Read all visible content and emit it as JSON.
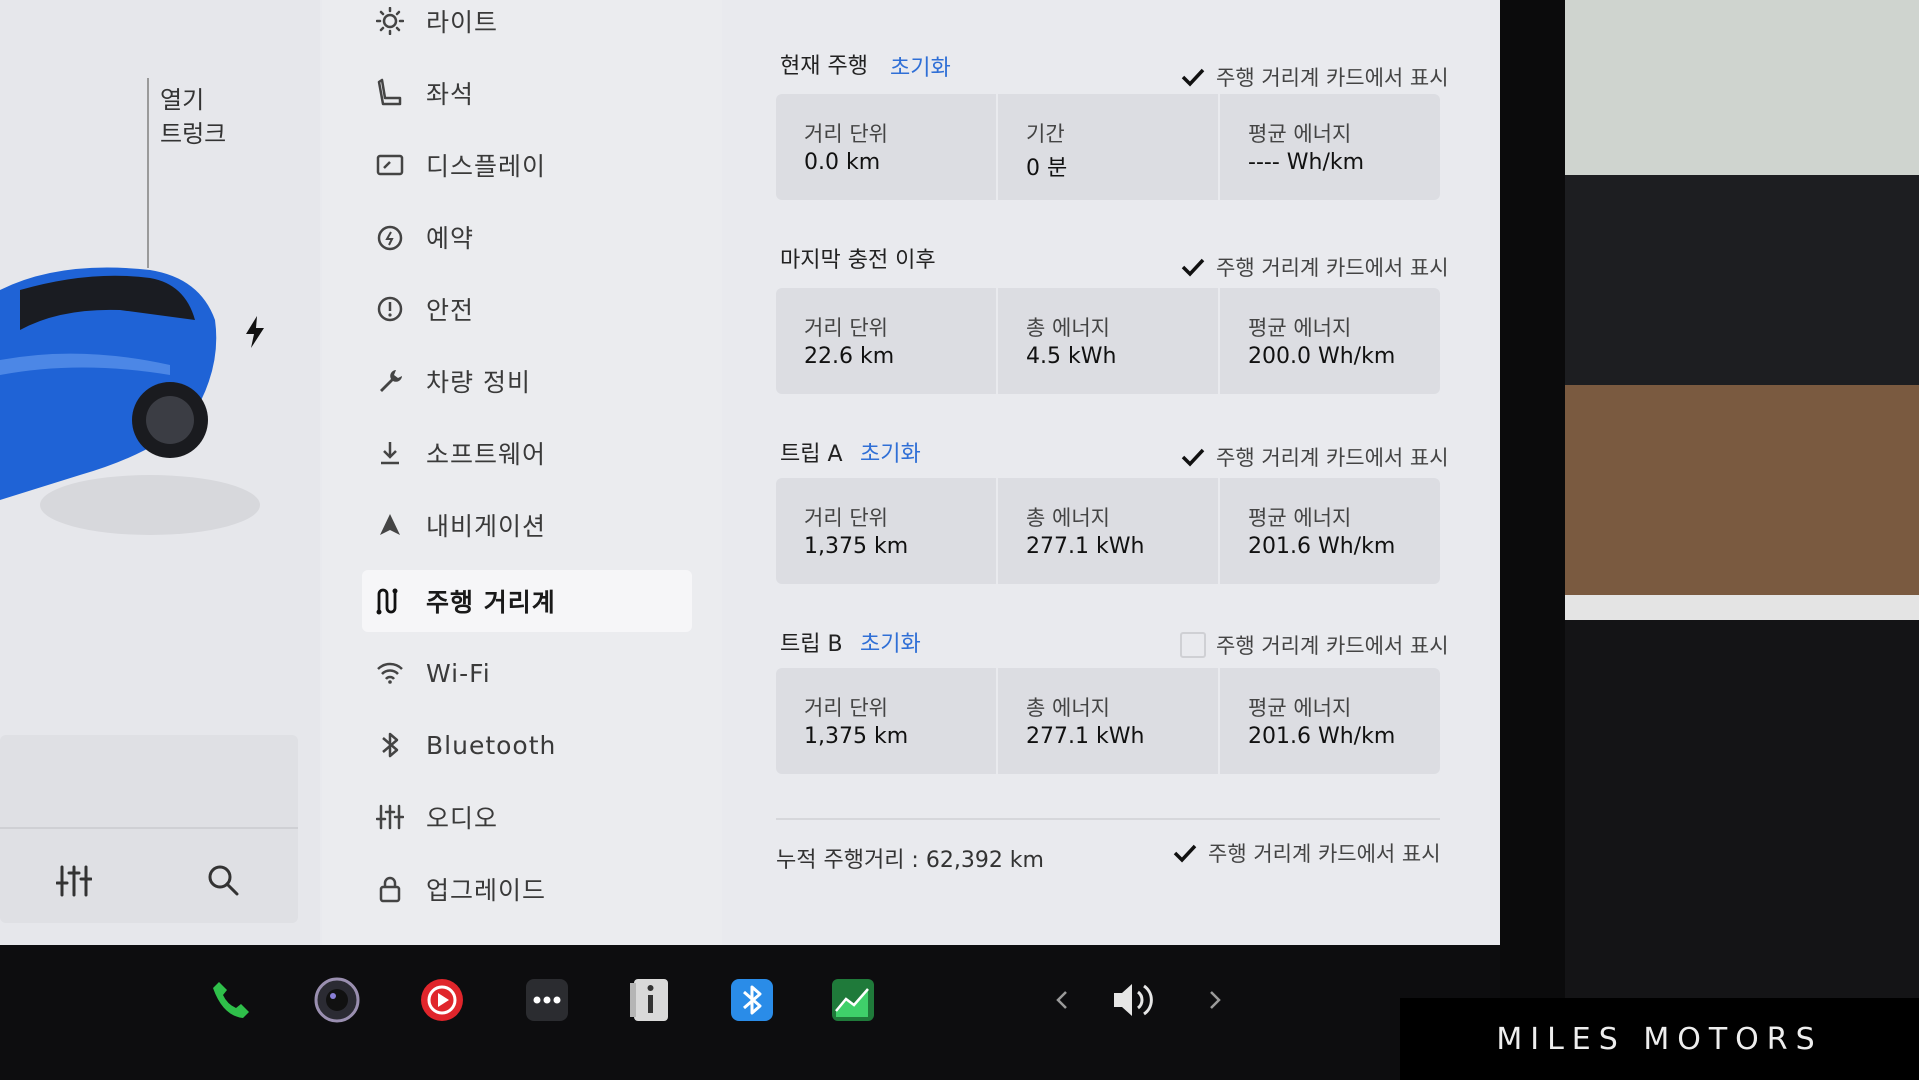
{
  "car_pane": {
    "trunk_open": "열기",
    "trunk_label": "트렁크"
  },
  "menu": {
    "items": [
      {
        "label": "라이트",
        "icon": "light-icon"
      },
      {
        "label": "좌석",
        "icon": "seat-icon"
      },
      {
        "label": "디스플레이",
        "icon": "display-icon"
      },
      {
        "label": "예약",
        "icon": "schedule-icon"
      },
      {
        "label": "안전",
        "icon": "safety-icon"
      },
      {
        "label": "차량 정비",
        "icon": "wrench-icon"
      },
      {
        "label": "소프트웨어",
        "icon": "download-icon"
      },
      {
        "label": "내비게이션",
        "icon": "navigation-icon"
      },
      {
        "label": "주행 거리계",
        "icon": "trips-icon",
        "active": true
      },
      {
        "label": "Wi-Fi",
        "icon": "wifi-icon"
      },
      {
        "label": "Bluetooth",
        "icon": "bluetooth-icon"
      },
      {
        "label": "오디오",
        "icon": "audio-icon"
      },
      {
        "label": "업그레이드",
        "icon": "lock-icon"
      }
    ]
  },
  "sections": {
    "current": {
      "title": "현재 주행",
      "reset": "초기화",
      "show_on_card": "주행 거리계 카드에서 표시",
      "show_checked": true,
      "stats": [
        {
          "label": "거리 단위",
          "value": "0.0  km"
        },
        {
          "label": "기간",
          "value": "0  분"
        },
        {
          "label": "평균 에너지",
          "value": "----  Wh/km"
        }
      ]
    },
    "since_charge": {
      "title": "마지막 충전 이후",
      "show_on_card": "주행 거리계 카드에서 표시",
      "show_checked": true,
      "stats": [
        {
          "label": "거리 단위",
          "value": "22.6  km"
        },
        {
          "label": "총 에너지",
          "value": "4.5  kWh"
        },
        {
          "label": "평균 에너지",
          "value": "200.0  Wh/km"
        }
      ]
    },
    "trip_a": {
      "title": "트립 A",
      "reset": "초기화",
      "show_on_card": "주행 거리계 카드에서 표시",
      "show_checked": true,
      "stats": [
        {
          "label": "거리 단위",
          "value": "1,375  km"
        },
        {
          "label": "총 에너지",
          "value": "277.1  kWh"
        },
        {
          "label": "평균 에너지",
          "value": "201.6  Wh/km"
        }
      ]
    },
    "trip_b": {
      "title": "트립 B",
      "reset": "초기화",
      "show_on_card": "주행 거리계 카드에서 표시",
      "show_checked": false,
      "stats": [
        {
          "label": "거리 단위",
          "value": "1,375  km"
        },
        {
          "label": "총 에너지",
          "value": "277.1  kWh"
        },
        {
          "label": "평균 에너지",
          "value": "201.6  Wh/km"
        }
      ]
    }
  },
  "odometer": {
    "text": "누적 주행거리 :  62,392  km",
    "show_on_card": "주행 거리계 카드에서 표시",
    "show_checked": true
  },
  "taskbar": {
    "icons": [
      "phone-icon",
      "camera-icon",
      "media-player-icon",
      "more-apps-icon",
      "manual-icon",
      "bluetooth-app-icon",
      "energy-app-icon",
      "volume-down-icon",
      "volume-icon",
      "volume-up-icon"
    ]
  },
  "watermark": "MILES MOTORS",
  "colors": {
    "screen_bg": "#e9eaee",
    "link_blue": "#2f6fd6",
    "car_blue": "#1f63d6",
    "phone_green": "#2fbf4a",
    "media_red": "#e0252b",
    "bluetooth_blue": "#2a8ce8"
  }
}
